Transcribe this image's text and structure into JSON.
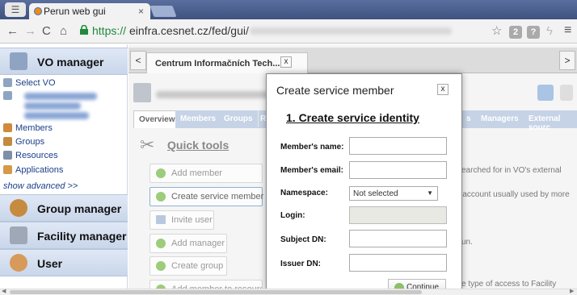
{
  "browser": {
    "tab_title": "Perun web gui",
    "tab_close": "×",
    "url_scheme": "https://",
    "url_rest": "einfra.cesnet.cz/fed/gui/",
    "ext1": "2",
    "ext2": "?",
    "menu": "≡"
  },
  "sidebar": {
    "vo_manager": "VO manager",
    "select_vo": "Select VO",
    "items": [
      "Members",
      "Groups",
      "Resources",
      "Applications"
    ],
    "show_advanced": "show advanced >>",
    "group_manager": "Group manager",
    "facility_manager": "Facility manager",
    "user": "User"
  },
  "main": {
    "left_arrow": "<",
    "right_arrow": ">",
    "tab_label": "Centrum Informačních Tech...",
    "tab_close": "x",
    "subtabs": [
      "Overview",
      "Members",
      "Groups"
    ],
    "subtabs_right": [
      "s",
      "Managers",
      "External sourc"
    ],
    "quick_tools": "Quick tools",
    "buttons": [
      "Add member",
      "Create service member",
      "Invite user",
      "Add manager",
      "Create group",
      "Add member to resource"
    ],
    "right_texts": [
      "earched for in VO's external",
      "(account usually used by more",
      "un.",
      "e type of access to Facility"
    ]
  },
  "modal": {
    "title": "Create service member",
    "close": "x",
    "step": "1. Create service identity",
    "fields": {
      "name_label": "Member's name:",
      "email_label": "Member's email:",
      "namespace_label": "Namespace:",
      "namespace_value": "Not selected",
      "login_label": "Login:",
      "subject_label": "Subject DN:",
      "issuer_label": "Issuer DN:"
    },
    "continue": "Continue"
  },
  "colors": {
    "accent": "#1b3f8a",
    "header_bg": "#c9d6ea",
    "url_green": "#1f8a3a"
  }
}
